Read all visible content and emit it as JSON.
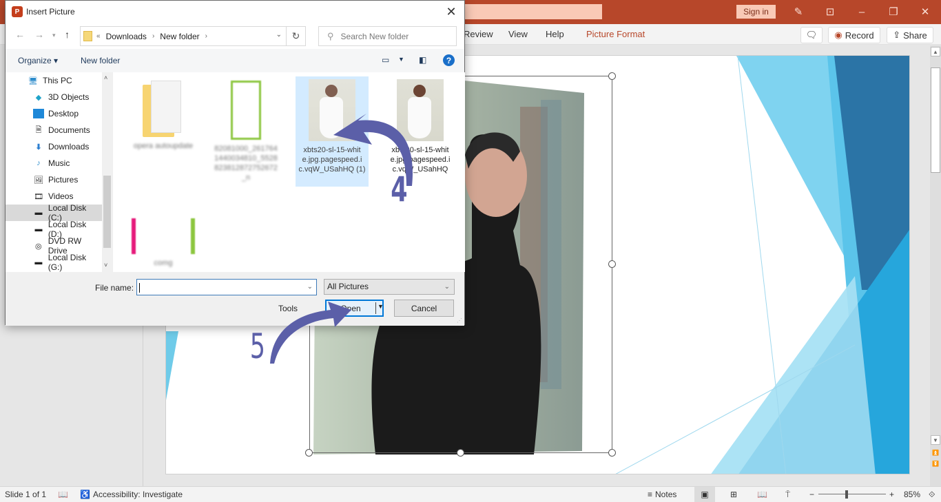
{
  "app": {
    "titlebar": {
      "signin_label": "Sign in",
      "window_buttons": [
        "minimize",
        "restore",
        "close"
      ]
    },
    "ribbon": {
      "tabs": [
        {
          "label": "Review",
          "active": false
        },
        {
          "label": "View",
          "active": false
        },
        {
          "label": "Help",
          "active": false
        },
        {
          "label": "Picture Format",
          "active": true
        }
      ],
      "record_label": "Record",
      "share_label": "Share"
    },
    "statusbar": {
      "slide_info": "Slide 1 of 1",
      "accessibility": "Accessibility: Investigate",
      "notes_label": "Notes",
      "zoom_level": "85%",
      "zoom_minus": "−",
      "zoom_plus": "+"
    },
    "colors": {
      "accent": "#b7472a",
      "annotation": "#5b5fa8",
      "selection": "#cce8ff",
      "focus": "#0078d7"
    }
  },
  "dialog": {
    "title": "Insert Picture",
    "breadcrumb": {
      "overflow": "«",
      "segments": [
        "Downloads",
        "New folder"
      ]
    },
    "search_placeholder": "Search New folder",
    "commands": {
      "organize_label": "Organize ▾",
      "new_folder_label": "New folder"
    },
    "nav_items": [
      {
        "label": "This PC",
        "icon": "computer-icon",
        "selected": false
      },
      {
        "label": "3D Objects",
        "icon": "cube-icon",
        "selected": false
      },
      {
        "label": "Desktop",
        "icon": "desktop-icon",
        "selected": false
      },
      {
        "label": "Documents",
        "icon": "document-icon",
        "selected": false
      },
      {
        "label": "Downloads",
        "icon": "download-icon",
        "selected": false
      },
      {
        "label": "Music",
        "icon": "music-icon",
        "selected": false
      },
      {
        "label": "Pictures",
        "icon": "picture-icon",
        "selected": false
      },
      {
        "label": "Videos",
        "icon": "video-icon",
        "selected": false
      },
      {
        "label": "Local Disk (C:)",
        "icon": "drive-icon",
        "selected": true
      },
      {
        "label": "Local Disk (D:)",
        "icon": "drive-icon",
        "selected": false
      },
      {
        "label": "DVD RW Drive",
        "icon": "dvd-drive-icon",
        "selected": false
      },
      {
        "label": "Local Disk (G:)",
        "icon": "drive-icon",
        "selected": false
      }
    ],
    "files": [
      {
        "name": "opera autoupdate",
        "type": "folder",
        "blurred": true,
        "selected": false
      },
      {
        "name": "82081000_261764 1440034810_5528 823812872752672 _n",
        "type": "image",
        "blurred": true,
        "selected": false
      },
      {
        "name": "xbts20-sl-15-whit e.jpg.pagespeed.i c.vqW_USahHQ (1)",
        "type": "image",
        "blurred": false,
        "selected": true
      },
      {
        "name": "xbts20-sl-15-whit e.jpg.pagespeed.i c.vqW_USahHQ",
        "type": "image",
        "blurred": false,
        "selected": false
      },
      {
        "name": "comg",
        "type": "image",
        "blurred": true,
        "selected": false
      }
    ],
    "filename_label": "File name:",
    "filename_value": "",
    "filter_value": "All Pictures",
    "tools_label": "Tools",
    "open_label": "Open",
    "cancel_label": "Cancel"
  },
  "annotations": {
    "step4": "4",
    "step5": "5"
  }
}
